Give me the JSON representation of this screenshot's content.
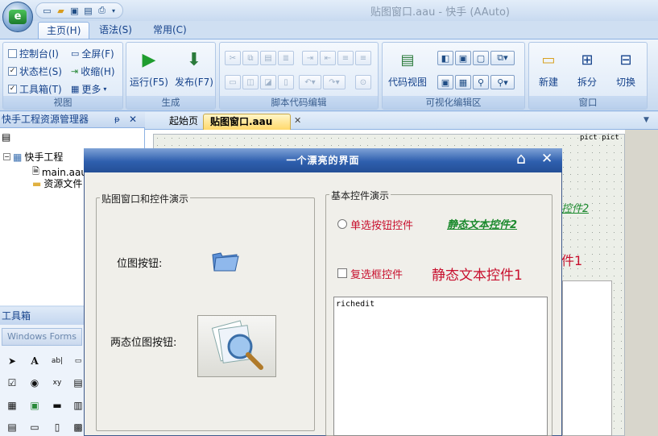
{
  "window": {
    "title": "贴图窗口.aau - 快手 (AAuto)",
    "colors": {
      "titlebar": "#c8daf0",
      "dialog_title": "#2e5fae",
      "accent_red": "#c8102e",
      "accent_green": "#1c8a2e"
    }
  },
  "orb": {
    "icon": "app-orb-icon"
  },
  "qat": {
    "icons": [
      "new-file-icon",
      "open-folder-icon",
      "save-icon",
      "save-all-icon",
      "print-icon",
      "dropdown-icon"
    ]
  },
  "tabs": [
    {
      "label": "主页(H)",
      "active": true
    },
    {
      "label": "语法(S)",
      "active": false
    },
    {
      "label": "常用(C)",
      "active": false
    }
  ],
  "ribbon": {
    "groups": [
      {
        "label": "视图",
        "items": [
          {
            "label": "控制台(I)",
            "checked": false
          },
          {
            "label": "状态栏(S)",
            "checked": true
          },
          {
            "label": "工具箱(T)",
            "checked": true
          },
          {
            "label": "全屏(F)"
          },
          {
            "label": "收缩(H)"
          },
          {
            "label": "更多"
          }
        ]
      },
      {
        "label": "生成",
        "items": [
          {
            "label": "运行(F5)"
          },
          {
            "label": "发布(F7)"
          }
        ]
      },
      {
        "label": "脚本代码编辑"
      },
      {
        "label": "可视化编辑区",
        "items": [
          {
            "label": "代码视图"
          }
        ]
      },
      {
        "label": "窗口",
        "items": [
          {
            "label": "新建"
          },
          {
            "label": "拆分"
          },
          {
            "label": "切换"
          }
        ]
      }
    ]
  },
  "resource_manager": {
    "title": "快手工程资源管理器",
    "tree": [
      {
        "label": "快手工程"
      },
      {
        "label": "main.aau"
      },
      {
        "label": "资源文件"
      }
    ]
  },
  "toolbox": {
    "title": "工具箱",
    "category": "Windows Forms"
  },
  "doc_tabs": [
    {
      "label": "起始页"
    },
    {
      "label": "贴图窗口.aau"
    }
  ],
  "canvas": {
    "pict_text": "pict pict",
    "faded_label_1": "控件2",
    "faded_label_2": "件1"
  },
  "dialog": {
    "title": "一个漂亮的界面",
    "left_group": {
      "title": "贴图窗口和控件演示",
      "bitmap_button_label": "位图按钮:",
      "twostate_button_label": "两态位图按钮:"
    },
    "right_group": {
      "title": "基本控件演示",
      "radio_label": "单选按钮控件",
      "static_text_2": "静态文本控件2",
      "checkbox_label": "复选框控件",
      "static_text_1": "静态文本控件1",
      "richedit_text": "richedit"
    }
  }
}
